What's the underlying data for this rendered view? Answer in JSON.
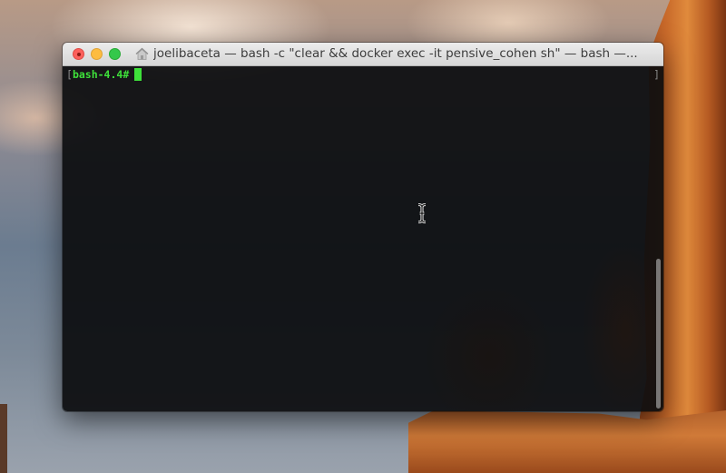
{
  "window": {
    "title": "joelibaceta — bash -c \"clear && docker exec -it pensive_cohen sh\" — bash —...",
    "buttons": {
      "close": "close",
      "minimize": "minimize",
      "zoom": "zoom"
    },
    "title_icon": "home-folder-icon"
  },
  "terminal": {
    "bracket_open": "[",
    "prompt": "bash-4.4#",
    "bracket_close": "]",
    "prompt_color": "#3ee03a",
    "background": "#0c0d0f"
  },
  "pointer": "text-cursor-ibeam"
}
